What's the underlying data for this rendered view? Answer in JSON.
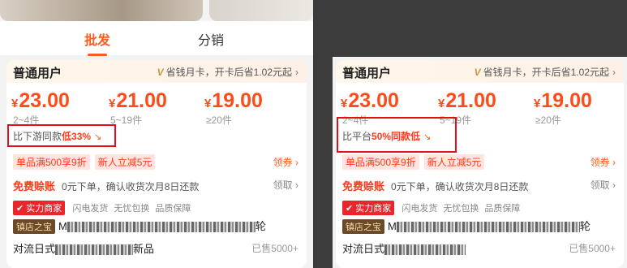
{
  "left": {
    "tabs": [
      "批发",
      "分销"
    ],
    "user_label": "普通用户",
    "promo": "省钱月卡，开卡后省1.02元起",
    "promo_v": "V",
    "prices": [
      {
        "sym": "¥",
        "val": "23.00",
        "qty": "2~4件"
      },
      {
        "sym": "¥",
        "val": "21.00",
        "qty": "5~19件"
      },
      {
        "sym": "¥",
        "val": "19.00",
        "qty": "≥20件"
      }
    ],
    "compare_prefix": "比下游同款",
    "compare_value": "低33%",
    "coupons": [
      "单品满500享9折",
      "新人立减5元"
    ],
    "coupon_action": "领券",
    "freepay_label": "免费赊账",
    "freepay_desc": "0元下单，确认收货次月8日还款",
    "claim_action": "领取",
    "shop_badge": "实力商家",
    "services": [
      "闪电发货",
      "无忧包换",
      "品质保障"
    ],
    "treasure": "镇店之宝",
    "title_start": "M",
    "title_end": "轮",
    "title2_start": "对流日式",
    "title2_end": "新品",
    "sold": "已售5000+"
  },
  "right": {
    "user_label": "普通用户",
    "promo": "省钱月卡，开卡后省1.02元起",
    "promo_v": "V",
    "prices": [
      {
        "sym": "¥",
        "val": "23.00",
        "qty": "2~4件"
      },
      {
        "sym": "¥",
        "val": "21.00",
        "qty": "5~19件"
      },
      {
        "sym": "¥",
        "val": "19.00",
        "qty": "≥20件"
      }
    ],
    "compare_prefix": "比平台",
    "compare_value": "50%同款低",
    "coupons": [
      "单品满500享9折",
      "新人立减5元"
    ],
    "coupon_action": "领券",
    "freepay_label": "免费赊账",
    "freepay_desc": "0元下单，确认收货次月8日还款",
    "claim_action": "领取",
    "shop_badge": "实力商家",
    "services": [
      "闪电发货",
      "无忧包换",
      "品质保障"
    ],
    "treasure": "镇店之宝",
    "title_start": "M",
    "title_end": "轮",
    "title2_start": "对流日式",
    "title2_end": "",
    "sold": "已售5000+"
  },
  "colors": {
    "accent": "#ff5a1a",
    "highlight_box": "#e0101a"
  }
}
